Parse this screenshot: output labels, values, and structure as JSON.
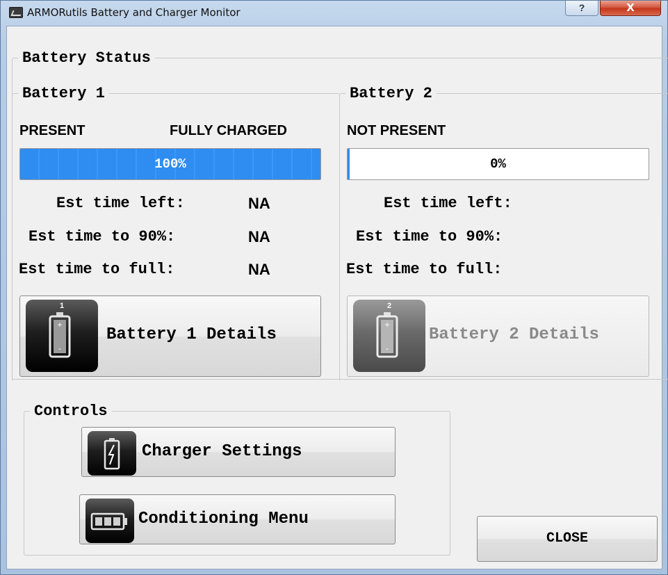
{
  "window": {
    "title": "ARMORutils Battery and Charger Monitor",
    "help_label": "?",
    "close_label": "X"
  },
  "battery_status": {
    "legend": "Battery Status",
    "battery1": {
      "legend": "Battery 1",
      "presence": "PRESENT",
      "charge_state": "FULLY CHARGED",
      "charge_percent": 100,
      "progress_text": "100%",
      "est_time_left_label": "Est time left:",
      "est_time_left_value": "NA",
      "est_time_90_label": "Est time to 90%:",
      "est_time_90_value": "NA",
      "est_time_full_label": "Est time to full:",
      "est_time_full_value": "NA",
      "details_button": "Battery 1 Details",
      "icon_number": "1"
    },
    "battery2": {
      "legend": "Battery 2",
      "presence": "NOT PRESENT",
      "charge_percent": 0,
      "progress_text": "0%",
      "est_time_left_label": "Est time left:",
      "est_time_90_label": "Est time to 90%:",
      "est_time_full_label": "Est time to full:",
      "details_button": "Battery 2 Details",
      "icon_number": "2"
    }
  },
  "controls": {
    "legend": "Controls",
    "charger_settings": "Charger Settings",
    "conditioning_menu": "Conditioning Menu"
  },
  "close_button": "CLOSE",
  "colors": {
    "progress_blue": "#2f8cf0",
    "titlebar": "#b7cde6",
    "close_red": "#c43418"
  },
  "icons": {
    "battery1": "battery-icon",
    "battery2": "battery-icon",
    "charger": "charger-battery-icon",
    "conditioning": "horizontal-battery-icon"
  }
}
